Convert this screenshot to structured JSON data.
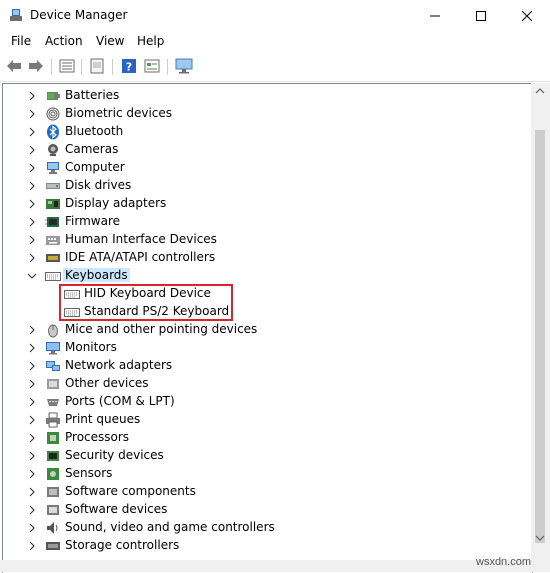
{
  "window": {
    "title": "Device Manager"
  },
  "menu": [
    "File",
    "Action",
    "View",
    "Help"
  ],
  "toolbar": {
    "buttons": [
      "back-icon",
      "forward-icon",
      "properties-icon",
      "driver-icon",
      "help-icon",
      "view-icon",
      "monitor-scan-icon"
    ]
  },
  "tree": {
    "categories": [
      {
        "label": "Batteries",
        "icon": "battery-icon",
        "expanded": false
      },
      {
        "label": "Biometric devices",
        "icon": "fingerprint-icon",
        "expanded": false
      },
      {
        "label": "Bluetooth",
        "icon": "bluetooth-icon",
        "expanded": false
      },
      {
        "label": "Cameras",
        "icon": "camera-icon",
        "expanded": false
      },
      {
        "label": "Computer",
        "icon": "computer-icon",
        "expanded": false
      },
      {
        "label": "Disk drives",
        "icon": "disk-drive-icon",
        "expanded": false
      },
      {
        "label": "Display adapters",
        "icon": "display-adapter-icon",
        "expanded": false
      },
      {
        "label": "Firmware",
        "icon": "firmware-icon",
        "expanded": false
      },
      {
        "label": "Human Interface Devices",
        "icon": "hid-icon",
        "expanded": false
      },
      {
        "label": "IDE ATA/ATAPI controllers",
        "icon": "ide-controller-icon",
        "expanded": false
      },
      {
        "label": "Keyboards",
        "icon": "keyboard-icon",
        "expanded": true,
        "selected": true,
        "children": [
          {
            "label": "HID Keyboard Device",
            "icon": "keyboard-icon"
          },
          {
            "label": "Standard PS/2 Keyboard",
            "icon": "keyboard-icon"
          }
        ]
      },
      {
        "label": "Mice and other pointing devices",
        "icon": "mouse-icon",
        "expanded": false
      },
      {
        "label": "Monitors",
        "icon": "monitor-icon",
        "expanded": false
      },
      {
        "label": "Network adapters",
        "icon": "network-adapter-icon",
        "expanded": false
      },
      {
        "label": "Other devices",
        "icon": "other-devices-icon",
        "expanded": false
      },
      {
        "label": "Ports (COM & LPT)",
        "icon": "port-icon",
        "expanded": false
      },
      {
        "label": "Print queues",
        "icon": "printer-icon",
        "expanded": false
      },
      {
        "label": "Processors",
        "icon": "processor-icon",
        "expanded": false
      },
      {
        "label": "Security devices",
        "icon": "security-device-icon",
        "expanded": false
      },
      {
        "label": "Sensors",
        "icon": "sensor-icon",
        "expanded": false
      },
      {
        "label": "Software components",
        "icon": "software-component-icon",
        "expanded": false
      },
      {
        "label": "Software devices",
        "icon": "software-device-icon",
        "expanded": false
      },
      {
        "label": "Sound, video and game controllers",
        "icon": "sound-icon",
        "expanded": false
      },
      {
        "label": "Storage controllers",
        "icon": "storage-controller-icon",
        "expanded": false
      }
    ]
  },
  "watermark": "wsxdn.com",
  "colors": {
    "highlight_box": "#d9232f",
    "selection": "#cce8ff",
    "accent_blue": "#1c6cc8"
  }
}
